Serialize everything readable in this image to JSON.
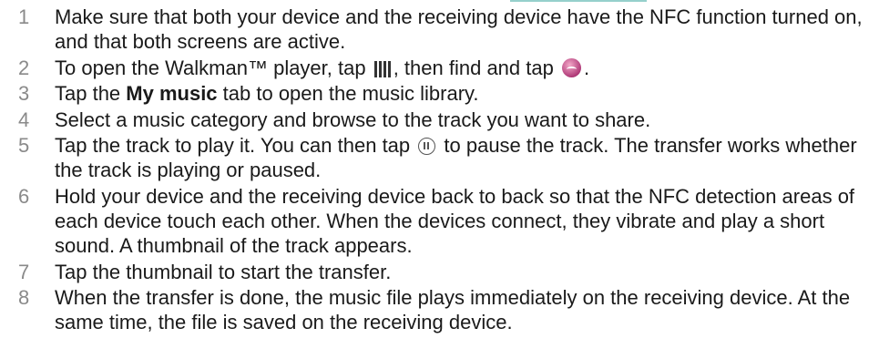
{
  "steps": [
    {
      "number": "1",
      "text": "Make sure that both your device and the receiving device have the NFC function turned on, and that both screens are active."
    },
    {
      "number": "2",
      "pre": "To open the Walkman™ player, tap ",
      "mid": ", then find and tap ",
      "post": ".",
      "icons": [
        "apps-grid-icon",
        "walkman-icon"
      ]
    },
    {
      "number": "3",
      "pre": "Tap the ",
      "bold": "My music",
      "post": " tab to open the music library."
    },
    {
      "number": "4",
      "text": "Select a music category and browse to the track you want to share."
    },
    {
      "number": "5",
      "pre": "Tap the track to play it. You can then tap ",
      "post": " to pause the track. The transfer works whether the track is playing or paused.",
      "icons": [
        "pause-icon"
      ]
    },
    {
      "number": "6",
      "text": "Hold your device and the receiving device back to back so that the NFC detection areas of each device touch each other. When the devices connect, they vibrate and play a short sound. A thumbnail of the track appears."
    },
    {
      "number": "7",
      "text": "Tap the thumbnail to start the transfer."
    },
    {
      "number": "8",
      "text": "When the transfer is done, the music file plays immediately on the receiving device. At the same time, the file is saved on the receiving device."
    }
  ],
  "colors": {
    "text": "#1a1a1a",
    "step_number": "#8a8a8a",
    "walkman_icon": "#b03a78",
    "heading_teal": "#3fa9a3"
  }
}
